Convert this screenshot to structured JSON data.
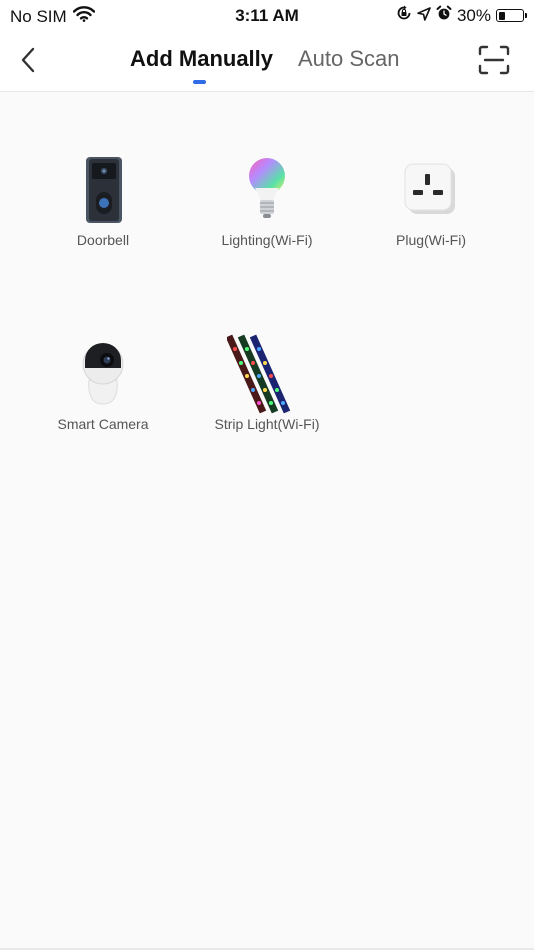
{
  "status_bar": {
    "carrier": "No SIM",
    "time": "3:11 AM",
    "battery_percent": "30%",
    "battery_level": 0.3
  },
  "nav": {
    "tabs": [
      {
        "label": "Add Manually",
        "active": true
      },
      {
        "label": "Auto Scan",
        "active": false
      }
    ],
    "accent_color": "#2f6ce6"
  },
  "devices": [
    {
      "label": "Doorbell",
      "icon": "doorbell-icon"
    },
    {
      "label": "Lighting(Wi-Fi)",
      "icon": "light-bulb-icon"
    },
    {
      "label": "Plug(Wi-Fi)",
      "icon": "plug-icon"
    },
    {
      "label": "Smart Camera",
      "icon": "camera-icon"
    },
    {
      "label": "Strip Light(Wi-Fi)",
      "icon": "strip-light-icon"
    }
  ]
}
